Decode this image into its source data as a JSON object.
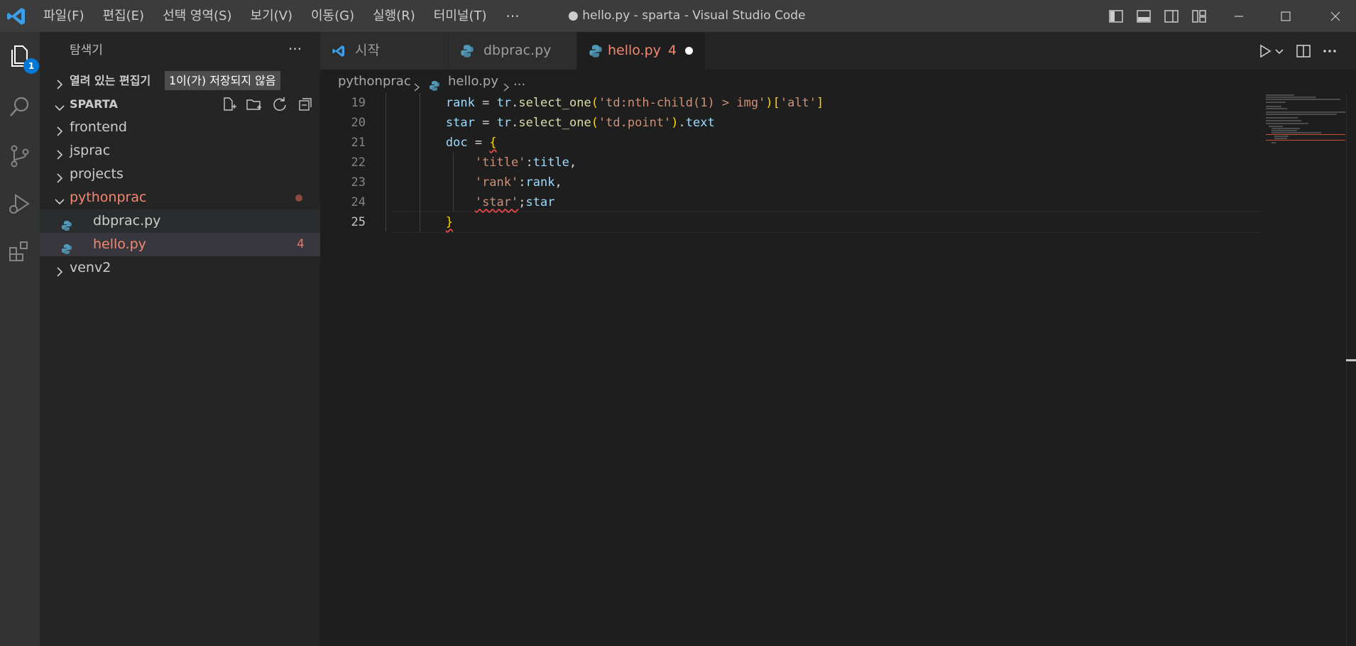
{
  "titlebar": {
    "menu": [
      "파일(F)",
      "편집(E)",
      "선택 영역(S)",
      "보기(V)",
      "이동(G)",
      "실행(R)",
      "터미널(T)"
    ],
    "more": "···",
    "title": "● hello.py - sparta - Visual Studio Code"
  },
  "activity": {
    "icons": [
      "explorer-icon",
      "search-icon",
      "source-control-icon",
      "run-debug-icon",
      "extensions-icon"
    ],
    "explorer_badge": "1"
  },
  "sidebar": {
    "title": "탐색기",
    "more": "···",
    "open_editors": "열려 있는 편집기",
    "open_editors_tooltip": "1이(가) 저장되지 않음",
    "workspace": "SPARTA",
    "items": [
      {
        "label": "frontend"
      },
      {
        "label": "jsprac"
      },
      {
        "label": "projects"
      },
      {
        "label": "pythonprac"
      },
      {
        "label": "dbprac.py"
      },
      {
        "label": "hello.py",
        "problems": "4"
      },
      {
        "label": "venv2"
      }
    ]
  },
  "tabs": [
    {
      "label": "시작",
      "icon": "vscode-icon"
    },
    {
      "label": "dbprac.py",
      "icon": "python-icon"
    },
    {
      "label": "hello.py",
      "problems": "4",
      "icon": "python-icon",
      "active": true,
      "dirty": true
    }
  ],
  "breadcrumb": {
    "folder": "pythonprac",
    "file": "hello.py",
    "tail": "..."
  },
  "editor": {
    "line_numbers": [
      "19",
      "20",
      "21",
      "22",
      "23",
      "24",
      "25"
    ],
    "current_line": "25"
  },
  "colors": {
    "accent": "#0078d4",
    "error": "#f48771",
    "titlebar": "#3c3c3c",
    "sidebar": "#252526",
    "editor": "#1e1e1e"
  }
}
